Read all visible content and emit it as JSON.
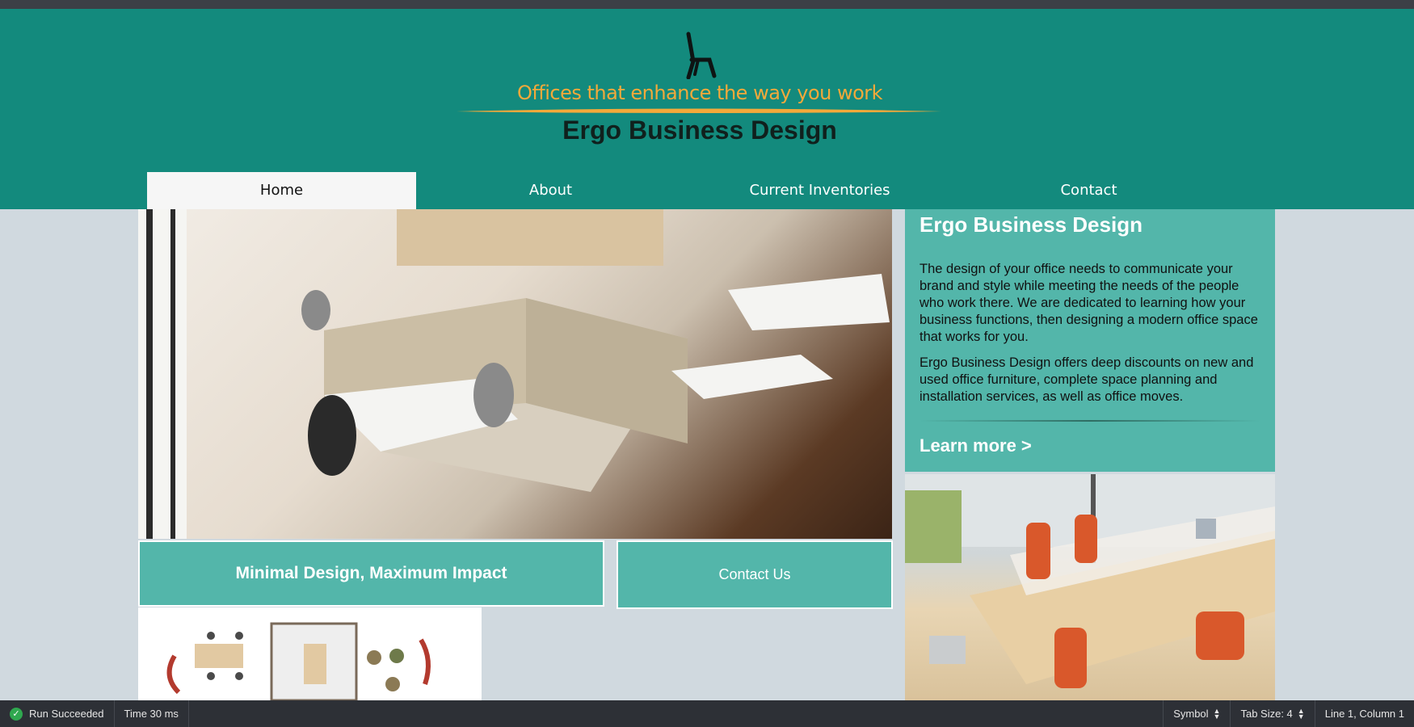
{
  "header": {
    "tagline": "Offices that enhance the way you work",
    "brand": "Ergo Business Design",
    "logo_icon": "office-chair-icon"
  },
  "nav": [
    {
      "label": "Home",
      "active": true
    },
    {
      "label": "About",
      "active": false
    },
    {
      "label": "Current Inventories",
      "active": false
    },
    {
      "label": "Contact",
      "active": false
    }
  ],
  "panel": {
    "title": "Ergo Business Design",
    "p1": "The design of your office needs to communicate your brand and style while meeting the needs of the people who work there. We are dedicated to learning how your business functions, then designing a modern office space that works for you.",
    "p2": "Ergo Business Design offers deep discounts on new and used office furniture, complete space planning and installation services, as well as office moves.",
    "learn_more": "Learn more >"
  },
  "tagline_box": "Minimal Design, Maximum Impact",
  "contact_button": "Contact Us",
  "statusbar": {
    "run_status": "Run Succeeded",
    "time": "Time 30 ms",
    "symbol": "Symbol",
    "tab_size": "Tab Size: 4",
    "cursor": "Line 1, Column 1"
  },
  "colors": {
    "header_teal": "#138a7d",
    "panel_teal": "#53b6aa",
    "accent_orange": "#f3a93a",
    "page_bg": "#d0d9df"
  }
}
